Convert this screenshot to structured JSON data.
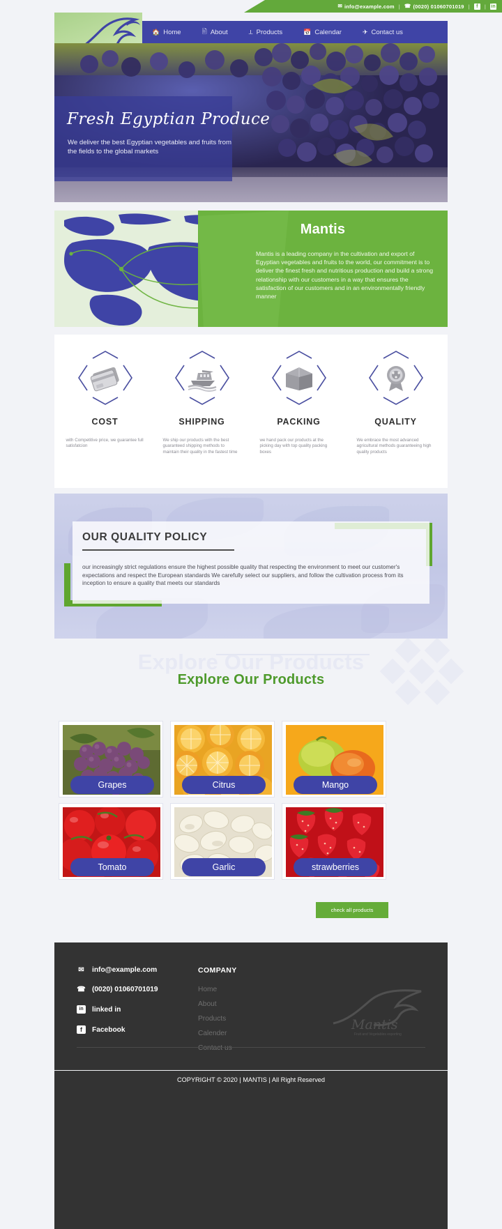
{
  "topbar": {
    "email": "info@example.com",
    "phone": "(0020) 01060701019",
    "facebook_icon": "facebook-icon",
    "linkedin_icon": "linkedin-icon",
    "separator": "|"
  },
  "logo": {
    "name": "Mantis",
    "tagline": "Fruit and Vegetables exporting"
  },
  "nav": {
    "items": [
      {
        "label": "Home",
        "icon": "home-icon",
        "glyph": "⌂"
      },
      {
        "label": "About",
        "icon": "id-card-icon",
        "glyph": "▣"
      },
      {
        "label": "Products",
        "icon": "leaf-icon",
        "glyph": "⊘"
      },
      {
        "label": "Calendar",
        "icon": "calendar-icon",
        "glyph": "☐"
      },
      {
        "label": "Contact us",
        "icon": "send-icon",
        "glyph": "➤"
      }
    ]
  },
  "hero": {
    "title": "Fresh Egyptian Produce",
    "subtitle": "We deliver the best Egyptian vegetables and fruits from the fields to the global markets"
  },
  "about": {
    "title": "Mantis",
    "text": "Mantis is a leading company in the cultivation and export of Egyptian vegetables and fruits to the world, our commitment is to deliver the finest fresh and nutritious production and build a strong relationship with our customers in a way that ensures the satisfaction of our customers and in an environmentally friendly manner"
  },
  "features": [
    {
      "label": "COST",
      "icon": "credit-card-icon",
      "desc": "with Competitive price, we guarantee full satisfatcion"
    },
    {
      "label": "SHIPPING",
      "icon": "ship-icon",
      "desc": "We ship our products with the best guaranteed shipping methods to maintain their quality in the fastest time"
    },
    {
      "label": "PACKING",
      "icon": "box-icon",
      "desc": "we hand pack our products at the picking day with top quality packing boxes"
    },
    {
      "label": "QUALITY",
      "icon": "award-badge-icon",
      "desc": "We embrace the most advanced agricultural methods guaranteeing high quality products"
    }
  ],
  "policy": {
    "title": "OUR QUALITY POLICY",
    "text": "our increasingly strict regulations ensure the highest possible quality that respecting the environment to meet our customer's expectations and respect the European standards We carefully select our suppliers, and follow the cultivation process from its inception to ensure a quality that meets our standards"
  },
  "products": {
    "ghost_title": "Explore Our Products",
    "title": "Explore Our Products",
    "check_all_label": "check all products",
    "items": [
      {
        "label": "Grapes",
        "image": "grapes-photo"
      },
      {
        "label": "Citrus",
        "image": "citrus-photo"
      },
      {
        "label": "Mango",
        "image": "mango-photo"
      },
      {
        "label": "Tomato",
        "image": "tomato-photo"
      },
      {
        "label": "Garlic",
        "image": "garlic-photo"
      },
      {
        "label": "strawberries",
        "image": "strawberries-photo"
      }
    ]
  },
  "footer": {
    "email": "info@example.com",
    "phone": "(0020) 01060701019",
    "linkedin": "linked in",
    "facebook": "Facebook",
    "company_title": "COMPANY",
    "links": [
      "Home",
      "About",
      "Products",
      "Calender",
      "Contact us"
    ],
    "copyright": "COPYRIGHT © 2020 | MANTIS | All Right Reserved",
    "watermark": "Mantis"
  },
  "colors": {
    "green": "#63a93b",
    "blue": "#3f44a6",
    "dark": "#333333",
    "product_green": "#4e9a2c"
  }
}
